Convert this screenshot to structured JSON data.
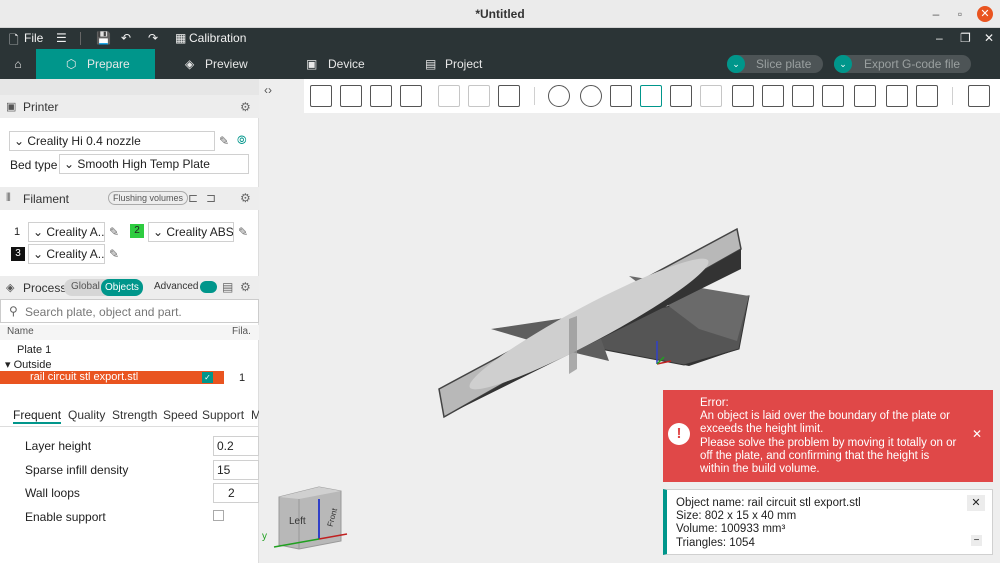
{
  "window": {
    "title": "*Untitled",
    "min": "–",
    "max": "▫",
    "close": "✕"
  },
  "menubar": {
    "file": "File",
    "calibration": "Calibration"
  },
  "nav": {
    "home_icon": "home-icon",
    "tabs": [
      {
        "label": "Prepare",
        "active": true
      },
      {
        "label": "Preview"
      },
      {
        "label": "Device"
      },
      {
        "label": "Project"
      }
    ],
    "slice": "Slice plate",
    "export": "Export G-code file"
  },
  "printer": {
    "section": "Printer",
    "selected": "Creality Hi 0.4 nozzle",
    "bed_label": "Bed type",
    "bed_value": "Smooth High Temp Plate"
  },
  "filament": {
    "section": "Filament",
    "flush": "Flushing volumes",
    "slots": [
      {
        "num": "1",
        "name": "Creality  A...",
        "color": "#ffffff"
      },
      {
        "num": "2",
        "name": "Creality  ABS",
        "color": "#2ecc40"
      },
      {
        "num": "3",
        "name": "Creality  A...",
        "color": "#111111"
      }
    ]
  },
  "process": {
    "section": "Process",
    "global": "Global",
    "objects": "Objects",
    "advanced": "Advanced",
    "search_placeholder": "Search plate, object and part.",
    "col_name": "Name",
    "col_fila": "Fila.",
    "plate": "Plate 1",
    "group": "Outside",
    "object": "rail circuit stl export.stl",
    "object_fila": "1"
  },
  "settings_tabs": [
    "Frequent",
    "Quality",
    "Strength",
    "Speed",
    "Support",
    "M"
  ],
  "settings": [
    {
      "label": "Layer height",
      "value": "0.2"
    },
    {
      "label": "Sparse infill density",
      "value": "15"
    },
    {
      "label": "Wall loops",
      "value": "2"
    },
    {
      "label": "Enable support",
      "value": ""
    }
  ],
  "viewcube": {
    "left": "Left",
    "front": "Front",
    "y": "y"
  },
  "error": {
    "line1": "Error:",
    "line2": "An object is laid over the boundary of the plate or",
    "line3": "exceeds the height limit.",
    "line4": "Please solve the problem by moving it totally on or",
    "line5": "off the plate, and confirming that the height is",
    "line6": "within the build volume.",
    "close": "✕"
  },
  "info": {
    "name": "Object name: rail circuit stl export.stl",
    "size": "Size: 802 x 15 x 40 mm",
    "volume": "Volume: 100933 mm³",
    "triangles": "Triangles: 1054",
    "close": "✕",
    "collapse": "−"
  },
  "colors": {
    "accent": "#00968b",
    "error": "#e04848",
    "dark": "#2b3436"
  }
}
